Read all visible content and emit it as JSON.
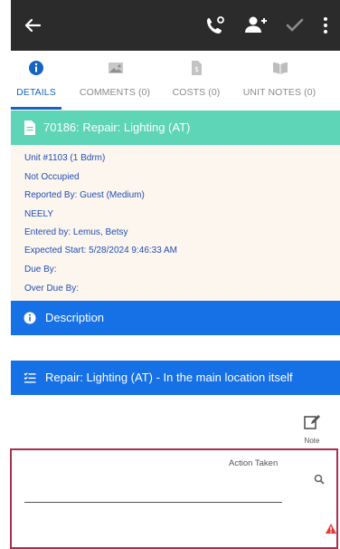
{
  "tabs": [
    {
      "label": "DETAILS",
      "icon": "info-icon",
      "active": true
    },
    {
      "label": "COMMENTS (0)",
      "icon": "image-icon",
      "active": false
    },
    {
      "label": "COSTS (0)",
      "icon": "invoice-icon",
      "active": false
    },
    {
      "label": "UNIT NOTES (0)",
      "icon": "book-icon",
      "active": false
    }
  ],
  "work_order": {
    "title": "70186: Repair: Lighting (AT)",
    "details": [
      "Unit #1103 (1 Bdrm)",
      "Not Occupied",
      "Reported By: Guest  (Medium)",
      "NEELY",
      "Entered by: Lemus, Betsy",
      "Expected Start: 5/28/2024 9:46:33 AM",
      "Due By:",
      "Over Due By:"
    ]
  },
  "description_section": {
    "title": "Description"
  },
  "task_section": {
    "title": "Repair: Lighting (AT) - In the main location itself"
  },
  "note_button": {
    "label": "Note"
  },
  "action_taken": {
    "label": "Action Taken",
    "value": ""
  },
  "colors": {
    "appbar": "#2b2b2b",
    "accent_blue": "#1565c0",
    "teal_header": "#5dd5b6",
    "blue_header": "#1670e6",
    "details_bg": "#fdf6ef",
    "error_border": "#a73050",
    "warning": "#e53935"
  }
}
